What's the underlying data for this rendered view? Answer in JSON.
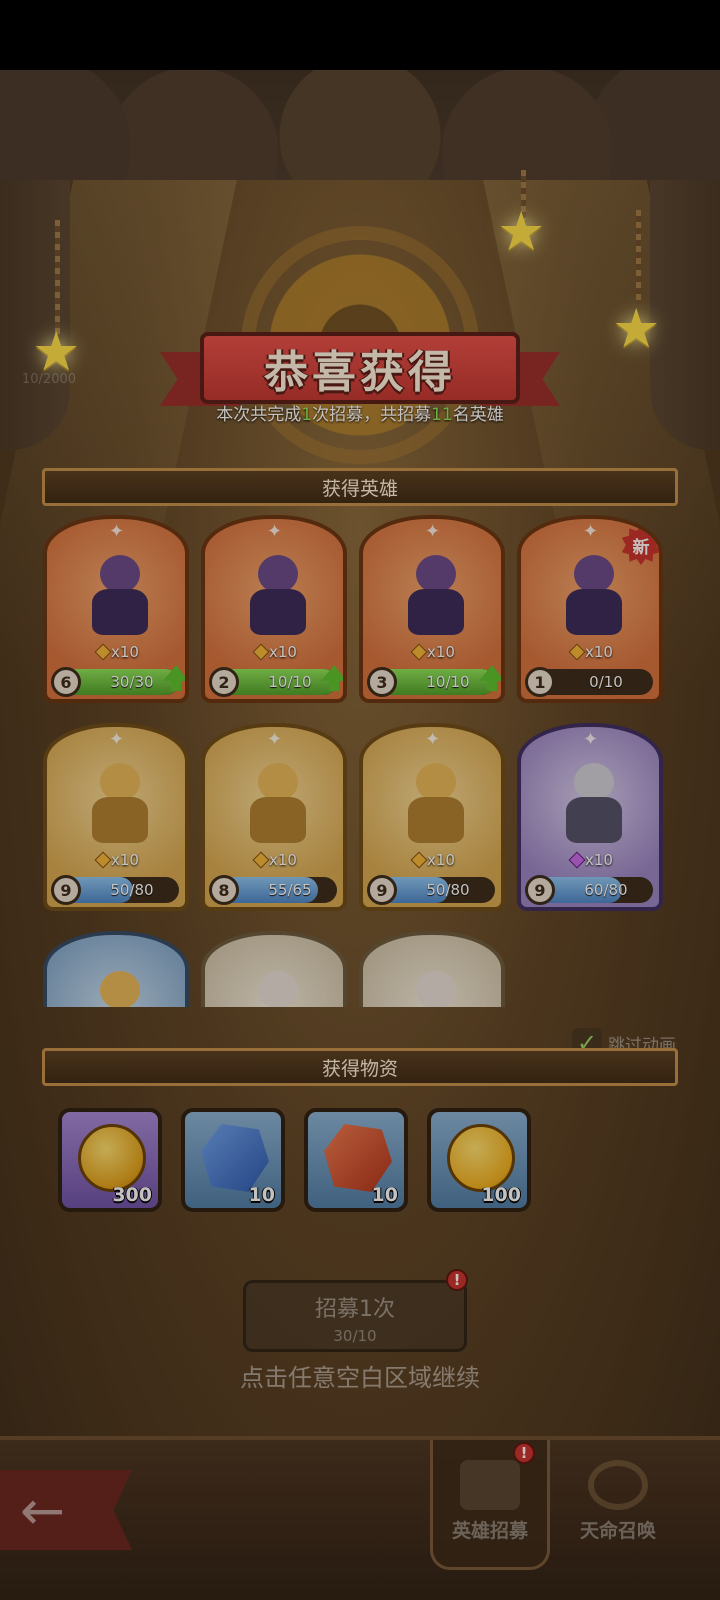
{
  "header": {
    "title": "恭喜获得",
    "summary_prefix": "本次共完成",
    "recruit_count": "1",
    "summary_mid": "次招募，共招募",
    "hero_count": "11",
    "summary_suffix": "名英雄",
    "faint_progress": "10/2000"
  },
  "sections": {
    "heroes_title": "获得英雄",
    "items_title": "获得物资"
  },
  "heroes": [
    {
      "rarity": "orange",
      "shards": "x10",
      "level": "6",
      "progress_text": "30/30",
      "progress": 1.0,
      "upgradable": true,
      "is_new": false
    },
    {
      "rarity": "orange",
      "shards": "x10",
      "level": "2",
      "progress_text": "10/10",
      "progress": 1.0,
      "upgradable": true,
      "is_new": false
    },
    {
      "rarity": "orange",
      "shards": "x10",
      "level": "3",
      "progress_text": "10/10",
      "progress": 1.0,
      "upgradable": true,
      "is_new": false
    },
    {
      "rarity": "orange",
      "shards": "x10",
      "level": "1",
      "progress_text": "0/10",
      "progress": 0.0,
      "upgradable": false,
      "is_new": true,
      "new_label": "新"
    },
    {
      "rarity": "gold",
      "shards": "x10",
      "level": "9",
      "progress_text": "50/80",
      "progress": 0.625,
      "upgradable": false,
      "is_new": false
    },
    {
      "rarity": "gold",
      "shards": "x10",
      "level": "8",
      "progress_text": "55/65",
      "progress": 0.846,
      "upgradable": false,
      "is_new": false
    },
    {
      "rarity": "gold",
      "shards": "x10",
      "level": "9",
      "progress_text": "50/80",
      "progress": 0.625,
      "upgradable": false,
      "is_new": false
    },
    {
      "rarity": "purple",
      "shards": "x10",
      "level": "9",
      "progress_text": "60/80",
      "progress": 0.75,
      "upgradable": false,
      "is_new": false
    }
  ],
  "skip_animation_label": "跳过动画",
  "items": [
    {
      "icon": "smiley-coin-icon",
      "count": "300"
    },
    {
      "icon": "blue-stone-icon",
      "count": "10"
    },
    {
      "icon": "red-stone-icon",
      "count": "10"
    },
    {
      "icon": "spade-coin-icon",
      "count": "100"
    }
  ],
  "recruit_button": {
    "label": "招募1次",
    "cost": "30/10",
    "alert": "!"
  },
  "continue_hint": "点击任意空白区域继续",
  "bottom_nav": {
    "back_icon": "←",
    "tab_hero_recruit": "英雄招募",
    "tab_destiny_summon": "天命召唤",
    "tab_alert": "!"
  },
  "colors": {
    "highlight_green": "#8ae35a",
    "ribbon_red": "#c23632"
  }
}
